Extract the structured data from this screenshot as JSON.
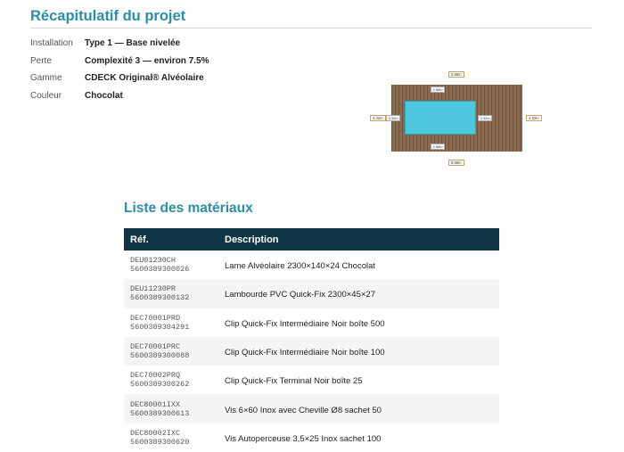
{
  "summary": {
    "title": "Récapitulatif du projet",
    "rows": [
      {
        "label": "Installation",
        "value": "Type 1 — Base nivelée"
      },
      {
        "label": "Perte",
        "value": "Complexité 3 — environ 7.5%"
      },
      {
        "label": "Gamme",
        "value": "CDECK Original® Alvéolaire"
      },
      {
        "label": "Couleur",
        "value": "Chocolat"
      }
    ]
  },
  "plan": {
    "top_outer": "8.86m",
    "top_inner": "4.68m",
    "bottom_inner": "4.68m",
    "bottom_outer": "8.86m",
    "left_outer": "4.32m",
    "left_inner": "3.32m",
    "right_inner": "3.32m",
    "right_outer": "4.32m",
    "colors": {
      "deck": "#8a6b52",
      "pool": "#4ec9df",
      "tag_border": "#c8a25a"
    }
  },
  "materials": {
    "title": "Liste des matériaux",
    "headers": {
      "ref": "Réf.",
      "description": "Description"
    },
    "rows": [
      {
        "ref": "DEU01230CH",
        "ean": "5600389300026",
        "description": "Lame Alvéolaire 2300×140×24 Chocolat"
      },
      {
        "ref": "DEU11230PR",
        "ean": "5600389300132",
        "description": "Lambourde PVC Quick-Fix 2300×45×27"
      },
      {
        "ref": "DEC70001PRD",
        "ean": "5600389304291",
        "description": "Clip Quick-Fix Intermédiaire Noir boîte 500"
      },
      {
        "ref": "DEC70001PRC",
        "ean": "5600389300088",
        "description": "Clip Quick-Fix Intermédiaire Noir boîte 100"
      },
      {
        "ref": "DEC70002PRQ",
        "ean": "5600389300262",
        "description": "Clip Quick-Fix Terminal Noir boîte 25"
      },
      {
        "ref": "DEC80001IXX",
        "ean": "5600389300613",
        "description": "Vis 6×60 Inox avec Cheville Ø8 sachet 50"
      },
      {
        "ref": "DEC80002IXC",
        "ean": "5600389300620",
        "description": "Vis Autoperceuse 3,5×25 Inox sachet 100"
      }
    ]
  },
  "theme": {
    "accent": "#2b8ea6",
    "table_header_bg": "#0d3544"
  }
}
